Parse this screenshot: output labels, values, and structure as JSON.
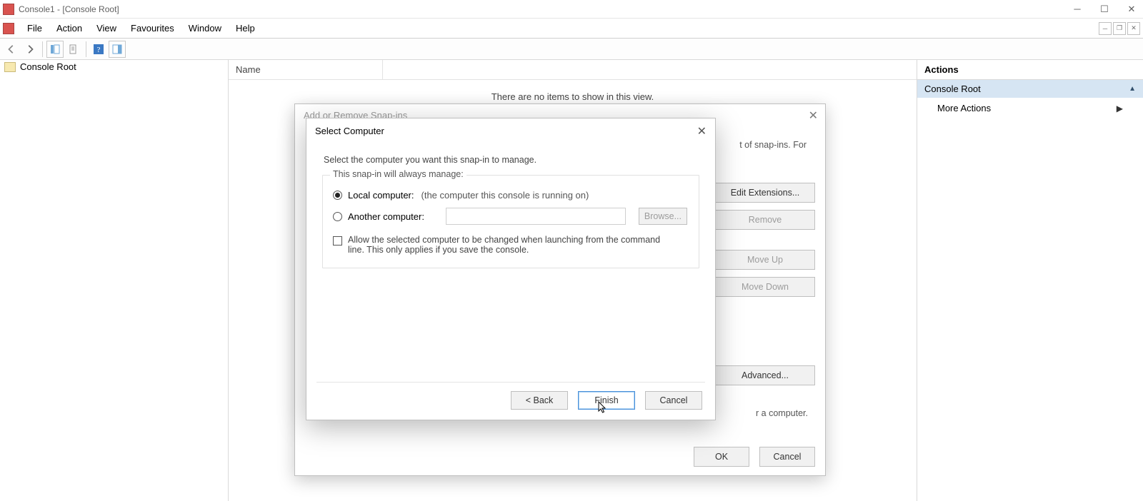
{
  "window": {
    "title": "Console1 - [Console Root]"
  },
  "menus": {
    "file": "File",
    "action": "Action",
    "view": "View",
    "favourites": "Favourites",
    "window": "Window",
    "help": "Help"
  },
  "tree": {
    "root": "Console Root"
  },
  "list": {
    "column_name": "Name",
    "empty_message": "There are no items to show in this view."
  },
  "actions": {
    "title": "Actions",
    "group": "Console Root",
    "more_actions": "More Actions"
  },
  "dialog_add_remove": {
    "title": "Add or Remove Snap-ins",
    "visible_snippet": "t of snap-ins. For",
    "buttons": {
      "edit_extensions": "Edit Extensions...",
      "remove": "Remove",
      "move_up": "Move Up",
      "move_down": "Move Down",
      "advanced": "Advanced...",
      "ok": "OK",
      "cancel": "Cancel"
    },
    "hint_tail": "r a computer."
  },
  "dialog_select_computer": {
    "title": "Select Computer",
    "lead": "Select the computer you want this snap-in to manage.",
    "group_title": "This snap-in will always manage:",
    "option_local_label": "Local computer:",
    "option_local_detail": "(the computer this console is running on)",
    "option_another_label": "Another computer:",
    "browse_label": "Browse...",
    "checkbox_label": "Allow the selected computer to be changed when launching from the command line.  This only applies if you save the console.",
    "buttons": {
      "back": "< Back",
      "finish": "Finish",
      "cancel": "Cancel"
    }
  }
}
